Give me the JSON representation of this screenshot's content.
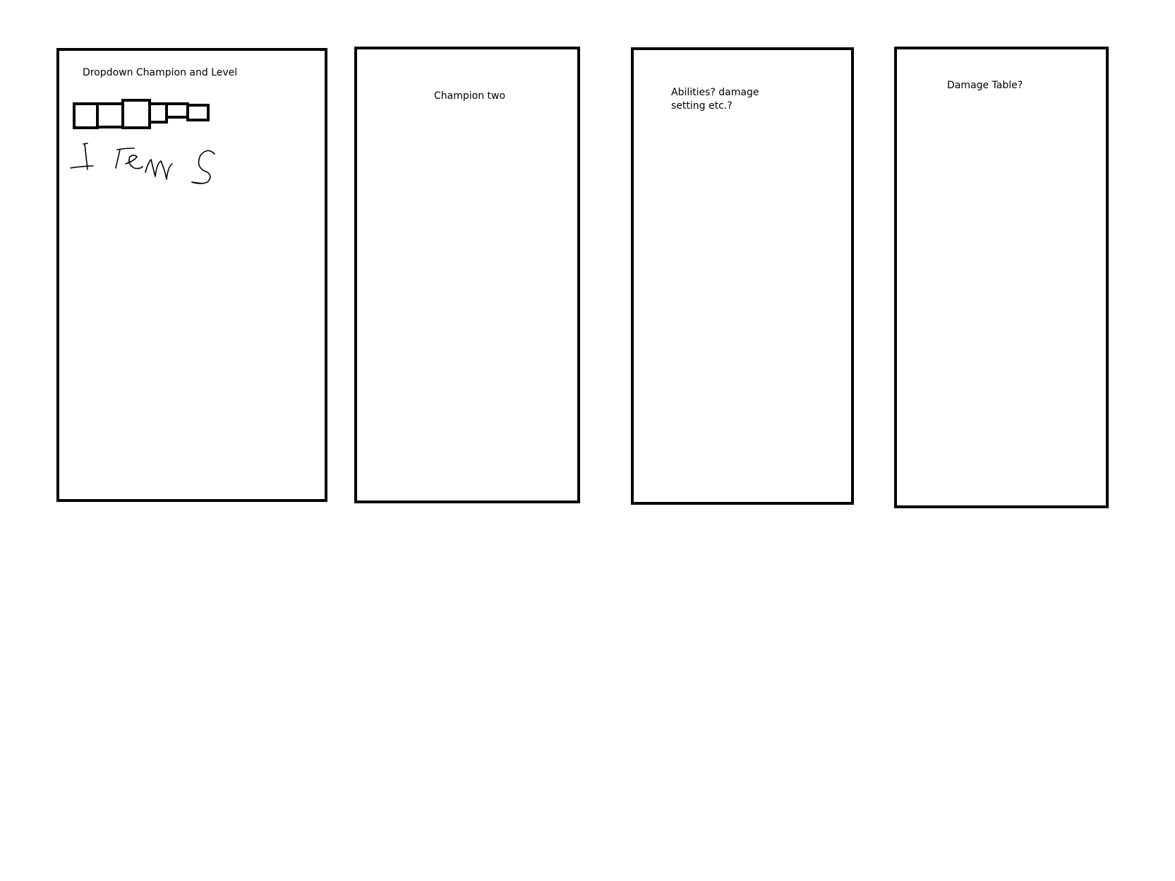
{
  "panels": [
    {
      "label": "Dropdown Champion and Level"
    },
    {
      "label": "Champion two"
    },
    {
      "label_lines": [
        "Abilities? damage",
        "setting etc.?"
      ]
    },
    {
      "label": "Damage Table?"
    }
  ],
  "item_slots_count": 6,
  "handwritten_note": "Items",
  "colors": {
    "stroke": "#000000",
    "background": "#ffffff"
  }
}
